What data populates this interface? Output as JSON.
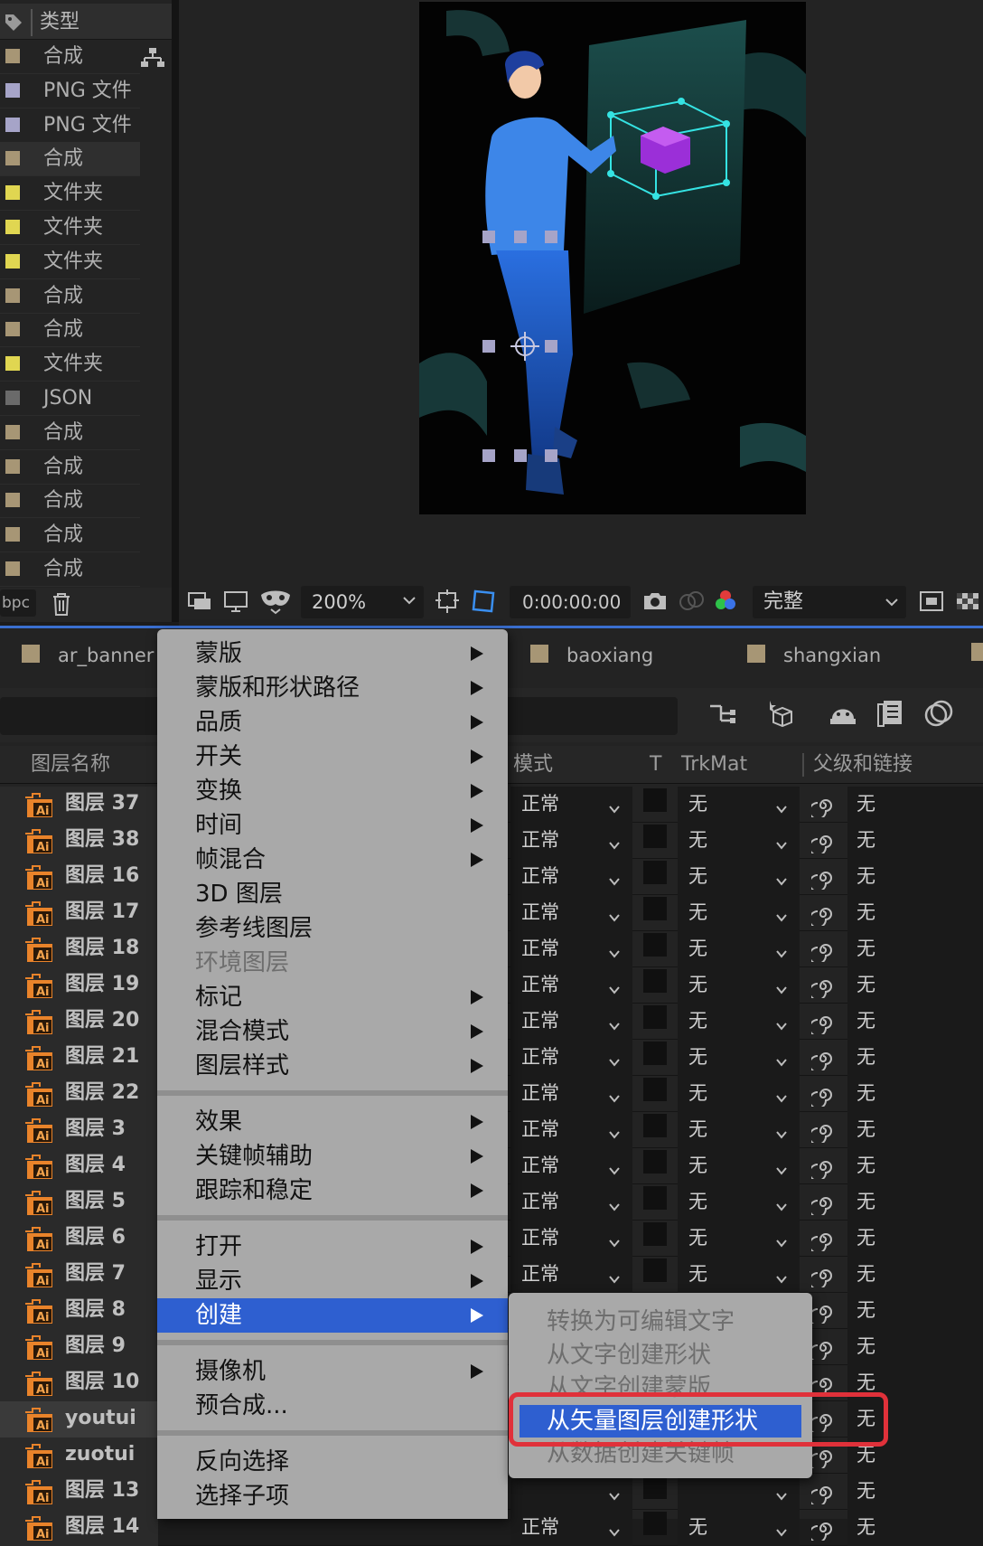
{
  "project": {
    "header_label": "类型",
    "items": [
      {
        "label": "合成",
        "color": "#a79675"
      },
      {
        "label": "PNG 文件",
        "color": "#a6a4c8"
      },
      {
        "label": "PNG 文件",
        "color": "#a6a4c8"
      },
      {
        "label": "合成",
        "color": "#a79675"
      },
      {
        "label": "文件夹",
        "color": "#e0d651"
      },
      {
        "label": "文件夹",
        "color": "#e0d651"
      },
      {
        "label": "文件夹",
        "color": "#e0d651"
      },
      {
        "label": "合成",
        "color": "#a79675"
      },
      {
        "label": "合成",
        "color": "#a79675"
      },
      {
        "label": "文件夹",
        "color": "#e0d651"
      },
      {
        "label": "JSON",
        "color": "#6a6a6a"
      },
      {
        "label": "合成",
        "color": "#a79675"
      },
      {
        "label": "合成",
        "color": "#a79675"
      },
      {
        "label": "合成",
        "color": "#a79675"
      },
      {
        "label": "合成",
        "color": "#a79675"
      },
      {
        "label": "合成",
        "color": "#a79675"
      }
    ],
    "footer_bpc": "bpc"
  },
  "viewer": {
    "zoom": "200%",
    "timecode": "0:00:00:00",
    "quality": "完整"
  },
  "timeline": {
    "tabs": [
      "ar_banner",
      "baoxiang",
      "shangxian"
    ],
    "columns": {
      "layer_name": "图层名称",
      "mode": "模式",
      "t": "T",
      "trkmat": "TrkMat",
      "parent": "父级和链接"
    },
    "layers": [
      {
        "name": "图层 37",
        "mode": "正常",
        "trkmat": "无",
        "parent": "无"
      },
      {
        "name": "图层 38",
        "mode": "正常",
        "trkmat": "无",
        "parent": "无"
      },
      {
        "name": "图层 16",
        "mode": "正常",
        "trkmat": "无",
        "parent": "无"
      },
      {
        "name": "图层 17",
        "mode": "正常",
        "trkmat": "无",
        "parent": "无"
      },
      {
        "name": "图层 18",
        "mode": "正常",
        "trkmat": "无",
        "parent": "无"
      },
      {
        "name": "图层 19",
        "mode": "正常",
        "trkmat": "无",
        "parent": "无"
      },
      {
        "name": "图层 20",
        "mode": "正常",
        "trkmat": "无",
        "parent": "无"
      },
      {
        "name": "图层 21",
        "mode": "正常",
        "trkmat": "无",
        "parent": "无"
      },
      {
        "name": "图层 22",
        "mode": "正常",
        "trkmat": "无",
        "parent": "无"
      },
      {
        "name": "图层 3",
        "mode": "正常",
        "trkmat": "无",
        "parent": "无"
      },
      {
        "name": "图层 4",
        "mode": "正常",
        "trkmat": "无",
        "parent": "无"
      },
      {
        "name": "图层 5",
        "mode": "正常",
        "trkmat": "无",
        "parent": "无"
      },
      {
        "name": "图层 6",
        "mode": "正常",
        "trkmat": "无",
        "parent": "无"
      },
      {
        "name": "图层 7",
        "mode": "正常",
        "trkmat": "无",
        "parent": "无"
      },
      {
        "name": "图层 8",
        "mode": "",
        "trkmat": "",
        "parent": "无"
      },
      {
        "name": "图层 9",
        "mode": "",
        "trkmat": "",
        "parent": "无"
      },
      {
        "name": "图层 10",
        "mode": "",
        "trkmat": "",
        "parent": "无"
      },
      {
        "name": "youtui",
        "mode": "",
        "trkmat": "",
        "parent": "无"
      },
      {
        "name": "zuotui",
        "mode": "",
        "trkmat": "",
        "parent": "无"
      },
      {
        "name": "图层 13",
        "mode": "",
        "trkmat": "",
        "parent": "无"
      },
      {
        "name": "图层 14",
        "mode": "正常",
        "trkmat": "无",
        "parent": "无"
      }
    ]
  },
  "context_menu": {
    "groups": [
      [
        {
          "label": "蒙版",
          "submenu": true
        },
        {
          "label": "蒙版和形状路径",
          "submenu": true
        },
        {
          "label": "品质",
          "submenu": true
        },
        {
          "label": "开关",
          "submenu": true
        },
        {
          "label": "变换",
          "submenu": true
        },
        {
          "label": "时间",
          "submenu": true
        },
        {
          "label": "帧混合",
          "submenu": true
        },
        {
          "label": "3D 图层",
          "submenu": false
        },
        {
          "label": "参考线图层",
          "submenu": false
        },
        {
          "label": "环境图层",
          "submenu": false,
          "disabled": true
        },
        {
          "label": "标记",
          "submenu": true
        },
        {
          "label": "混合模式",
          "submenu": true
        },
        {
          "label": "图层样式",
          "submenu": true
        }
      ],
      [
        {
          "label": "效果",
          "submenu": true
        },
        {
          "label": "关键帧辅助",
          "submenu": true
        },
        {
          "label": "跟踪和稳定",
          "submenu": true
        }
      ],
      [
        {
          "label": "打开",
          "submenu": true
        },
        {
          "label": "显示",
          "submenu": true
        },
        {
          "label": "创建",
          "submenu": true,
          "highlighted": true
        }
      ],
      [
        {
          "label": "摄像机",
          "submenu": true
        },
        {
          "label": "预合成...",
          "submenu": false
        }
      ],
      [
        {
          "label": "反向选择",
          "submenu": false
        },
        {
          "label": "选择子项",
          "submenu": false
        }
      ]
    ],
    "create_submenu": [
      {
        "label": "转换为可编辑文字",
        "disabled": true
      },
      {
        "label": "从文字创建形状",
        "disabled": true
      },
      {
        "label": "从文字创建蒙版",
        "disabled": true
      },
      {
        "label": "从矢量图层创建形状",
        "highlighted": true
      },
      {
        "label": "从数据创建关键帧",
        "disabled": true
      }
    ]
  },
  "colors": {
    "accent": "#2e5fd0",
    "annotation_red": "#e0313a",
    "comp_swatch": "#a79675",
    "png_swatch": "#a6a4c8",
    "folder_swatch": "#e0d651",
    "ai_orange": "#e9832a"
  }
}
